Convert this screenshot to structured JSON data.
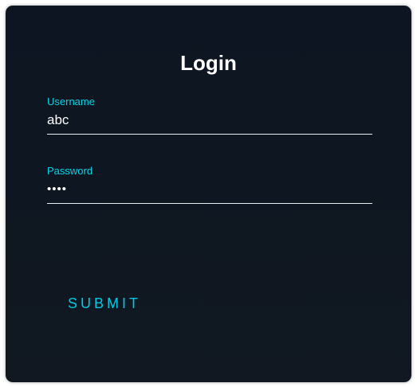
{
  "login": {
    "title": "Login",
    "username": {
      "label": "Username",
      "value": "abc"
    },
    "password": {
      "label": "Password",
      "value": "abcd"
    },
    "submit_label": "SUBMIT"
  },
  "colors": {
    "card_background": "#0e1620",
    "accent": "#03d6e8",
    "text": "#ffffff",
    "underline": "#e9eef2"
  }
}
